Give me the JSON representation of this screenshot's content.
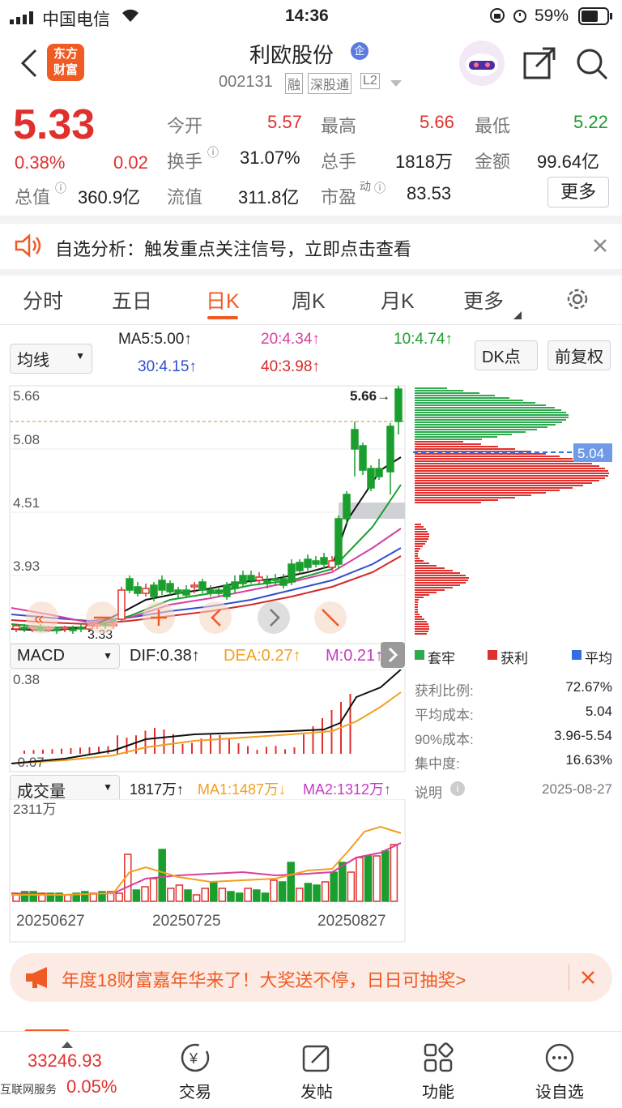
{
  "status": {
    "carrier": "中国电信",
    "time": "14:36",
    "battery": "59%"
  },
  "header": {
    "title": "利欧股份",
    "title_badge": "企",
    "code": "002131",
    "tags": [
      "融",
      "深股通",
      "L2"
    ],
    "logo_line1": "东方",
    "logo_line2": "财富"
  },
  "quote": {
    "price": "5.33",
    "change_pct": "0.38%",
    "change": "0.02",
    "open_label": "今开",
    "open": "5.57",
    "high_label": "最高",
    "high": "5.66",
    "low_label": "最低",
    "low": "5.22",
    "turnover_label": "换手",
    "turnover": "31.07%",
    "volume_label": "总手",
    "volume": "1818万",
    "amount_label": "金额",
    "amount": "99.64亿",
    "mcap_label": "总值",
    "mcap": "360.9亿",
    "float_label": "流值",
    "float": "311.8亿",
    "pe_label": "市盈",
    "pe_sup": "动",
    "pe": "83.53",
    "more": "更多"
  },
  "notice": {
    "text": "自选分析：触发重点关注信号，立即点击查看"
  },
  "tabs": {
    "items": [
      "分时",
      "五日",
      "日K",
      "周K",
      "月K",
      "更多"
    ],
    "active": "日K"
  },
  "ma_bar": {
    "select": "均线",
    "ma5": "MA5:5.00↑",
    "ma20": "20:4.34↑",
    "ma10": "10:4.74↑",
    "ma30": "30:4.15↑",
    "ma40": "40:3.98↑",
    "dk": "DK点",
    "adjust": "前复权"
  },
  "kline": {
    "y_labels": [
      "5.66",
      "5.08",
      "4.51",
      "3.93"
    ],
    "high_marker": "5.66→",
    "low_marker": "3.33",
    "cost_line": "5.04"
  },
  "macd_bar": {
    "select": "MACD",
    "dif": "DIF:0.38↑",
    "dea": "DEA:0.27↑",
    "m": "M:0.21↑",
    "top": "0.38",
    "bottom": "-0.07"
  },
  "vol_bar": {
    "select": "成交量",
    "vol": "1817万↑",
    "ma1": "MA1:1487万↓",
    "ma2": "MA2:1312万↑",
    "max": "2311万"
  },
  "dates": [
    "20250627",
    "20250725",
    "20250827"
  ],
  "chip": {
    "legend": [
      "套牢",
      "获利",
      "平均"
    ],
    "legend_colors": [
      "#2fa84f",
      "#e0302d",
      "#2f6fe0"
    ],
    "rows": [
      [
        "获利比例:",
        "72.67%"
      ],
      [
        "平均成本:",
        "5.04"
      ],
      [
        "90%成本:",
        "3.96-5.54"
      ],
      [
        "集中度:",
        "16.63%"
      ]
    ],
    "note": "说明",
    "date": "2025-08-27"
  },
  "promo": {
    "text": "年度18财富嘉年华来了！大奖送不停，日日可抽奖>"
  },
  "bottom": {
    "index": "33246.93",
    "label": "互联网服务",
    "pct": "0.05%",
    "items": [
      "交易",
      "发帖",
      "功能",
      "设自选"
    ]
  },
  "colors": {
    "up": "#e0302d",
    "down": "#1a9e2e",
    "accent": "#f05a23"
  }
}
